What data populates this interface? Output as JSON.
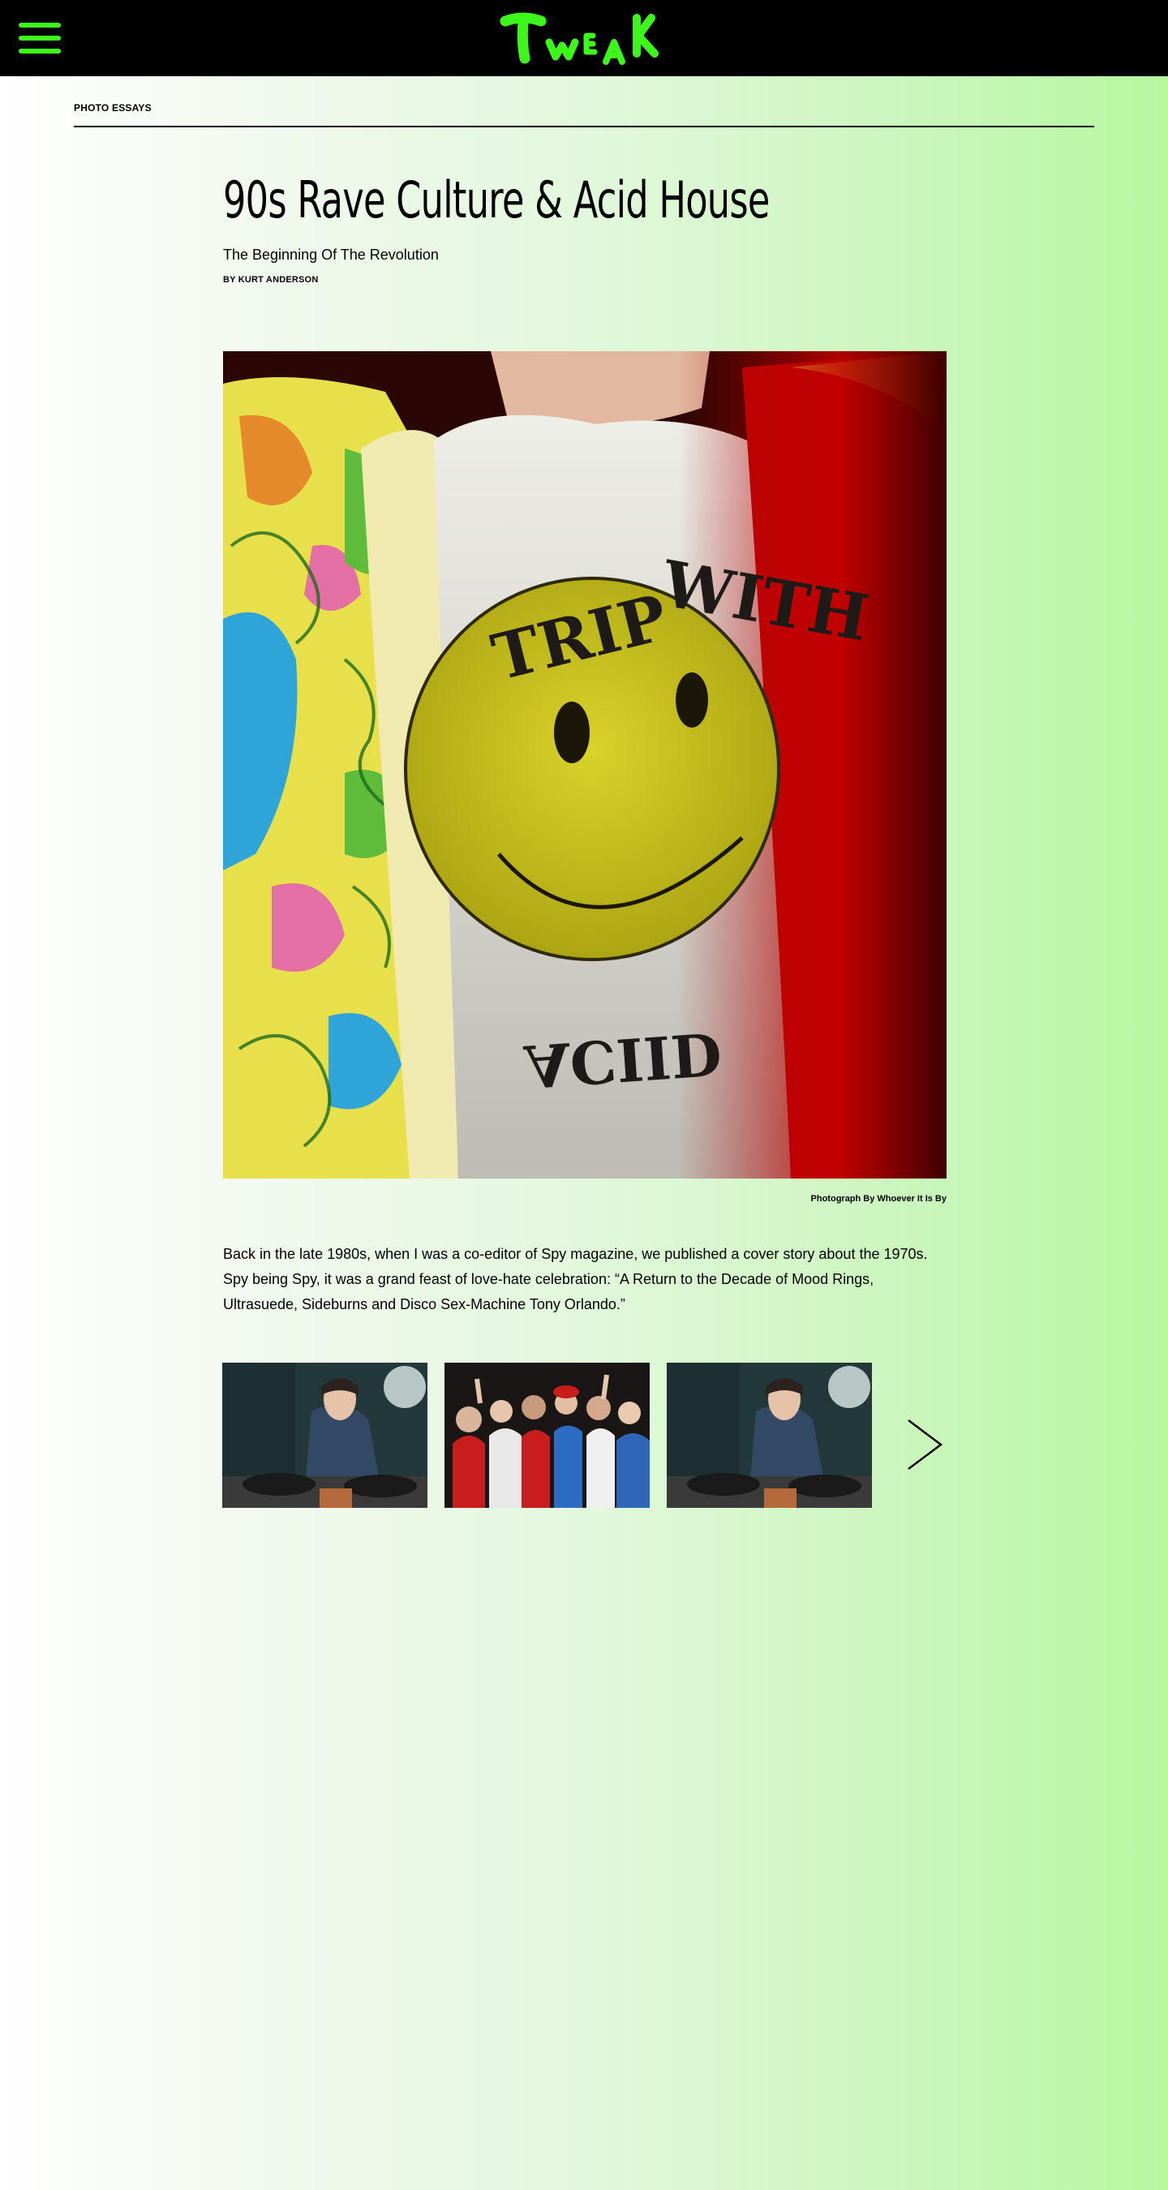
{
  "header": {
    "logo_text": "TWEAK",
    "menu_icon": "hamburger-menu-icon",
    "accent_color": "#3df61a",
    "background_color": "#000000"
  },
  "section": {
    "label": "PHOTO ESSAYS"
  },
  "article": {
    "title": "90s Rave Culture & Acid House",
    "subtitle": "The Beginning Of The Revolution",
    "byline": "BY KURT ANDERSON",
    "hero_shirt_text_top": "TRIP WITH",
    "hero_shirt_text_bottom": "ACIID",
    "photo_credit": "Photograph By Whoever It Is By",
    "body": "Back in the late 1980s, when I was a co-editor of Spy magazine, we published a cover story about the 1970s. Spy being Spy, it was a grand feast of love-hate celebration: “A Return to the Decade of Mood Rings, Ultrasuede, Sideburns and Disco Sex-Machine Tony Orlando.”"
  },
  "gallery": {
    "next_icon": "chevron-right-icon"
  }
}
